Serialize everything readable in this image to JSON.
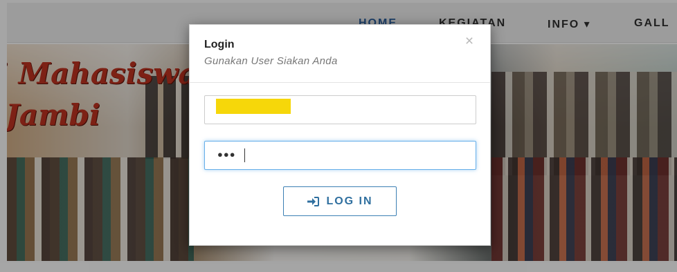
{
  "nav": {
    "items": [
      {
        "label": "HOME"
      },
      {
        "label": "KEGIATAN"
      },
      {
        "label": "INFO ▾"
      },
      {
        "label": "GALL"
      }
    ]
  },
  "banner": {
    "script_line_1": "i Mahasiswa",
    "script_line_2": "Jambi"
  },
  "modal": {
    "title": "Login",
    "subtitle": "Gunakan User Siakan Anda",
    "close_glyph": "×",
    "username": {
      "value": ""
    },
    "password": {
      "masked": "●●●"
    },
    "login_button": {
      "label": "LOG IN",
      "icon": "sign-in-icon"
    }
  },
  "colors": {
    "accent": "#2f6f9f",
    "focus": "#66afe9",
    "redaction": "#f6d70a"
  }
}
